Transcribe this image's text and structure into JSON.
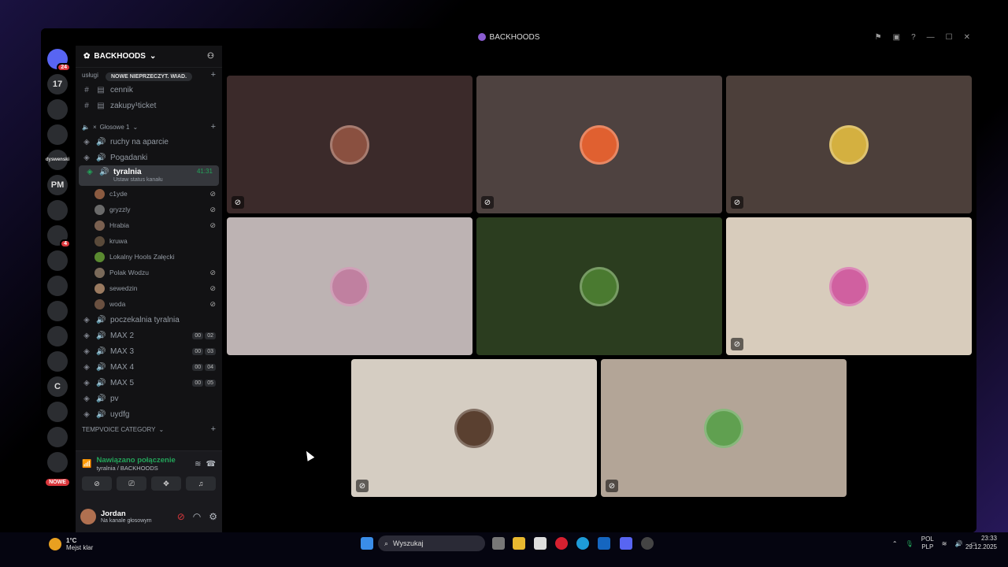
{
  "window": {
    "title": "BACKHOODS"
  },
  "guilds": [
    {
      "label": "",
      "icon": "discord-home-icon",
      "badge": "24"
    },
    {
      "label": "17",
      "icon": "server-17-icon"
    },
    {
      "label": "",
      "icon": "server-icon"
    },
    {
      "label": "",
      "icon": "server-icon"
    },
    {
      "label": "dyswenski",
      "icon": "server-icon"
    },
    {
      "label": "PM",
      "icon": "server-icon"
    },
    {
      "label": "",
      "icon": "server-icon"
    },
    {
      "label": "",
      "icon": "server-icon",
      "badge": "4"
    },
    {
      "label": "",
      "icon": "server-icon"
    },
    {
      "label": "",
      "icon": "server-icon"
    },
    {
      "label": "",
      "icon": "server-icon"
    },
    {
      "label": "",
      "icon": "server-icon"
    },
    {
      "label": "",
      "icon": "server-icon"
    },
    {
      "label": "C",
      "icon": "server-icon"
    },
    {
      "label": "",
      "icon": "server-icon"
    },
    {
      "label": "",
      "icon": "server-icon"
    },
    {
      "label": "",
      "icon": "server-icon"
    }
  ],
  "new_label": "NOWE",
  "sidebar": {
    "server_name": "BACKHOODS",
    "tooltip": "NOWE NIEPRZECZYT. WIAD.",
    "top_category": "usługi",
    "top_channels": [
      {
        "name": "cennik"
      },
      {
        "name": "zakupy¹ticket"
      }
    ],
    "voice_category": "Głosowe 1",
    "voice_channels_before": [
      {
        "name": "ruchy na aparcie"
      },
      {
        "name": "Pogadanki"
      }
    ],
    "active_channel": {
      "name": "tyralnia",
      "time": "41:31",
      "status": "Ustaw status kanału"
    },
    "members": [
      {
        "name": "c1yde",
        "muted": true
      },
      {
        "name": "gryzzly",
        "muted": true
      },
      {
        "name": "Hrabia",
        "muted": true
      },
      {
        "name": "kruwa",
        "muted": false
      },
      {
        "name": "Lokalny Hools Załęcki",
        "muted": false
      },
      {
        "name": "Polak Wodzu",
        "muted": true
      },
      {
        "name": "sewedzin",
        "muted": true
      },
      {
        "name": "woda",
        "muted": true
      }
    ],
    "voice_channels_after": [
      {
        "name": "poczekalnia tyralnia"
      },
      {
        "name": "MAX 2",
        "c1": "00",
        "c2": "02"
      },
      {
        "name": "MAX 3",
        "c1": "00",
        "c2": "03"
      },
      {
        "name": "MAX 4",
        "c1": "00",
        "c2": "04"
      },
      {
        "name": "MAX 5",
        "c1": "00",
        "c2": "05"
      },
      {
        "name": "pv"
      },
      {
        "name": "uydfg"
      }
    ],
    "temp_category": "TEMPVOICE CATEGORY"
  },
  "voice": {
    "status": "Nawiązano połączenie",
    "location": "tyralnia / BACKHOODS"
  },
  "user": {
    "name": "Jordan",
    "status": "Na kanale głosowym"
  },
  "tiles": [
    {
      "color": "#3b2a2a",
      "avatar_color": "#8a5040",
      "muted": true
    },
    {
      "color": "#4e4240",
      "avatar_color": "#e06030",
      "muted": true
    },
    {
      "color": "#4c3f3a",
      "avatar_color": "#d4b040",
      "muted": true
    },
    {
      "color": "#bdb3b3",
      "avatar_color": "#c080a0",
      "muted": false
    },
    {
      "color": "#2b3d1f",
      "avatar_color": "#4a7a30",
      "muted": false
    },
    {
      "color": "#d8ccbc",
      "avatar_color": "#d060a0",
      "muted": true
    },
    {
      "color": "#d5cdc2",
      "avatar_color": "#5a4030",
      "muted": true
    },
    {
      "color": "#b3a597",
      "avatar_color": "#60a050",
      "muted": true
    }
  ],
  "taskbar": {
    "weather_temp": "1°C",
    "weather_desc": "Mejst klar",
    "search": "Wyszukaj",
    "lang1": "POL",
    "lang2": "PLP",
    "time": "23:33",
    "date": "29.12.2025"
  }
}
